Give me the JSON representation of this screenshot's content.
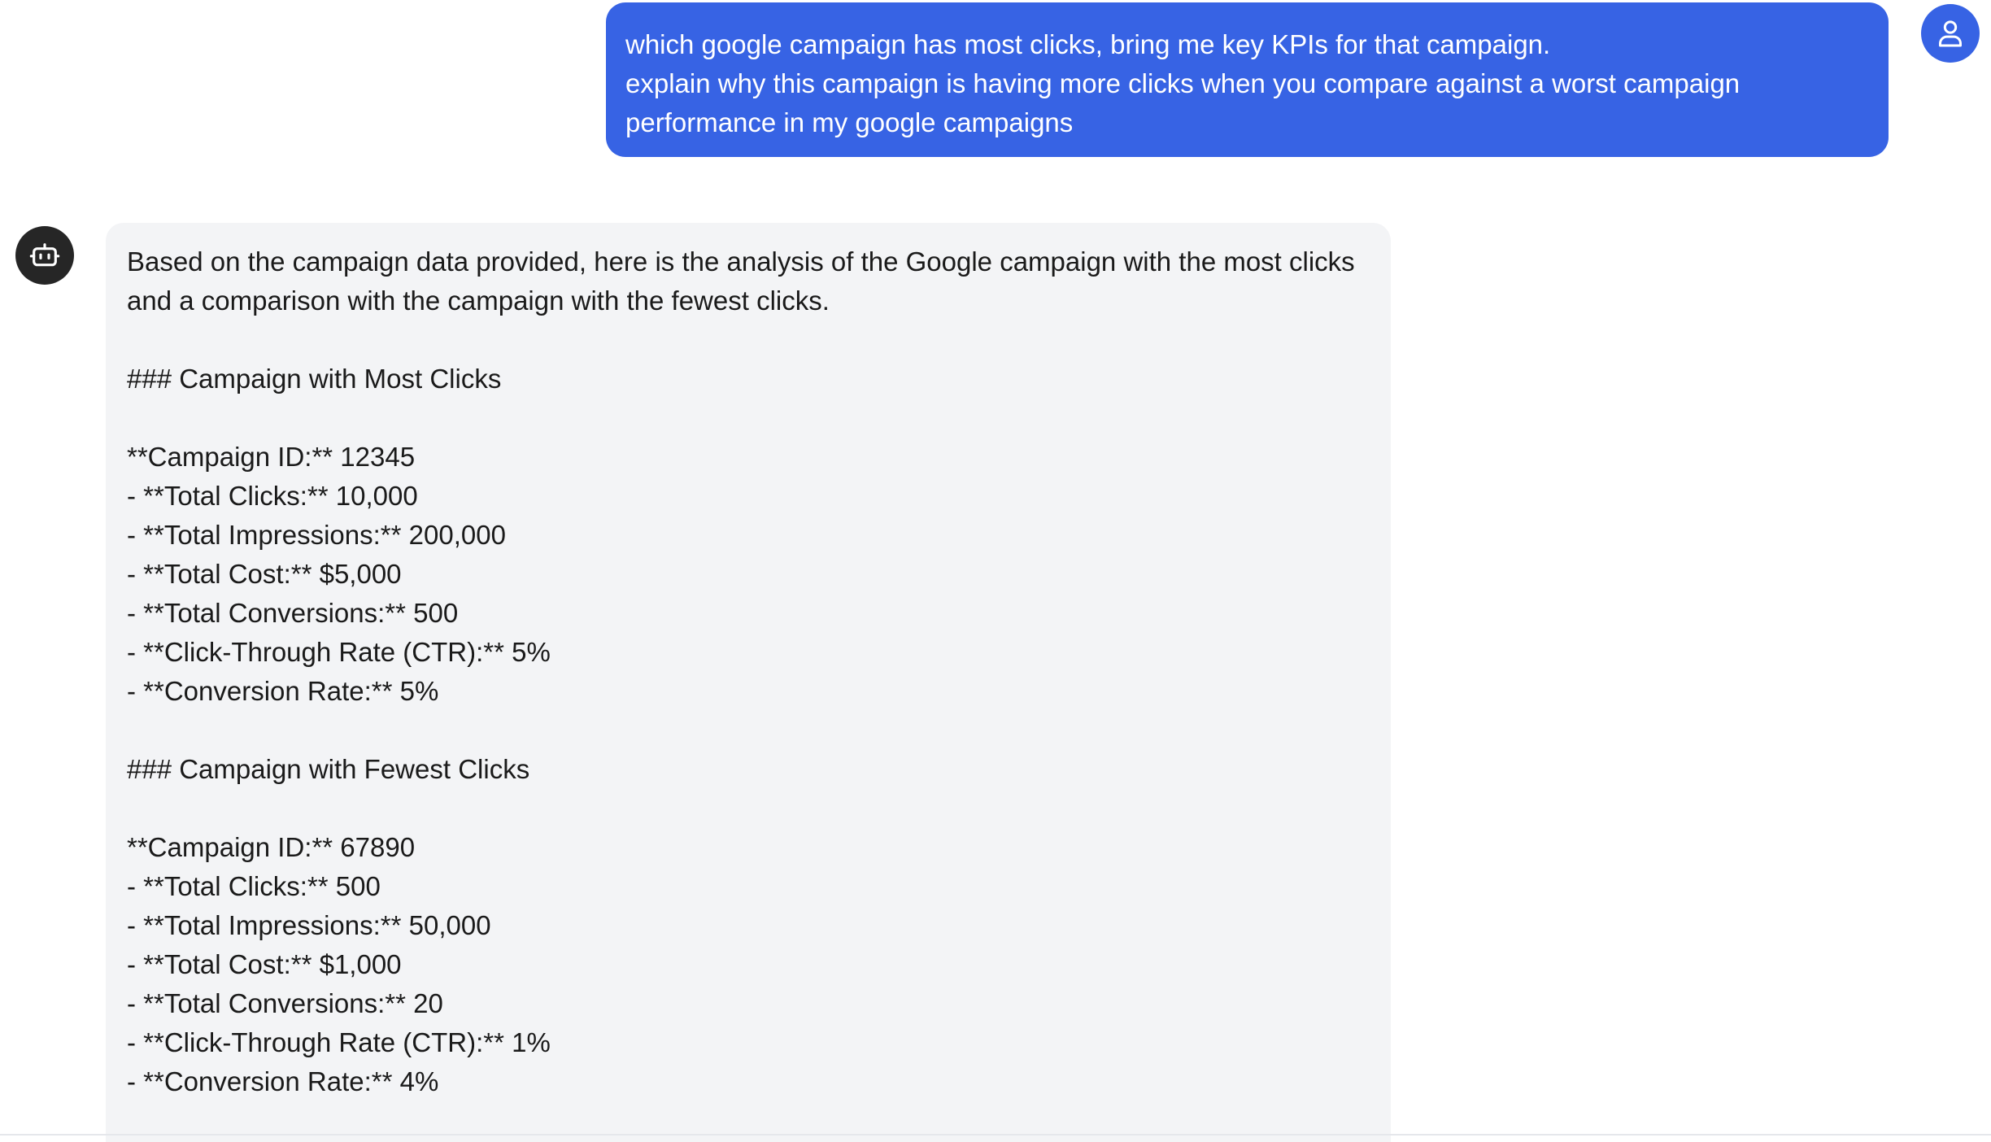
{
  "user_message": {
    "lines": [
      "which google campaign has most clicks, bring me key KPIs for that campaign.",
      "explain why this campaign is having more clicks when you compare against a worst campaign",
      "performance in my google campaigns"
    ],
    "bubble_color": "#3763e4",
    "avatar_icon": "user-icon"
  },
  "bot_message": {
    "avatar_icon": "robot-icon",
    "avatar_color": "#262626",
    "bubble_color": "#f3f4f6",
    "lines": [
      "Based on the campaign data provided, here is the analysis of the Google campaign with the most clicks",
      "and a comparison with the campaign with the fewest clicks.",
      "",
      "### Campaign with Most Clicks",
      "",
      "**Campaign ID:** 12345",
      "- **Total Clicks:** 10,000",
      "- **Total Impressions:** 200,000",
      "- **Total Cost:** $5,000",
      "- **Total Conversions:** 500",
      "- **Click-Through Rate (CTR):** 5%",
      "- **Conversion Rate:** 5%",
      "",
      "### Campaign with Fewest Clicks",
      "",
      "**Campaign ID:** 67890",
      "- **Total Clicks:** 500",
      "- **Total Impressions:** 50,000",
      "- **Total Cost:** $1,000",
      "- **Total Conversions:** 20",
      "- **Click-Through Rate (CTR):** 1%",
      "- **Conversion Rate:** 4%"
    ]
  }
}
